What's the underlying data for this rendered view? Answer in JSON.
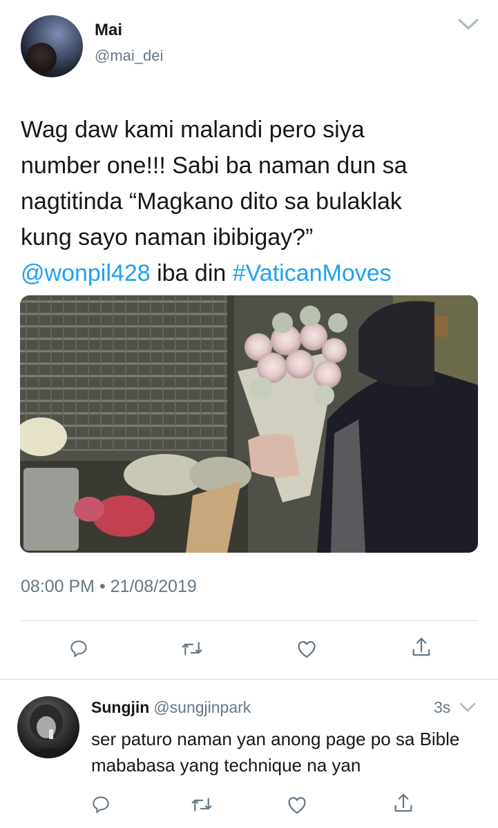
{
  "tweet": {
    "author_name": "Mai",
    "author_handle": "@mai_dei",
    "text_lines": [
      "Wag daw kami malandi pero siya",
      "number one!!! Sabi ba naman dun sa",
      "nagtitinda “Magkano dito sa bulaklak",
      "kung sayo naman ibibigay?”"
    ],
    "mention": "@wonpil428",
    "middle_text": " iba din ",
    "hashtag": "#VaticanMoves",
    "timestamp": "08:00 PM • 21/08/2019",
    "link_color": "#1da1f2",
    "photo_description_icon": "photo"
  },
  "actions": {
    "reply_icon": "reply-icon",
    "retweet_icon": "retweet-icon",
    "like_icon": "like-icon",
    "share_icon": "share-icon"
  },
  "reply": {
    "author_name": "Sungjin",
    "author_handle": "@sungjinpark",
    "time": "3s",
    "text": "ser paturo naman yan anong page po sa Bible mababasa yang technique na yan"
  }
}
